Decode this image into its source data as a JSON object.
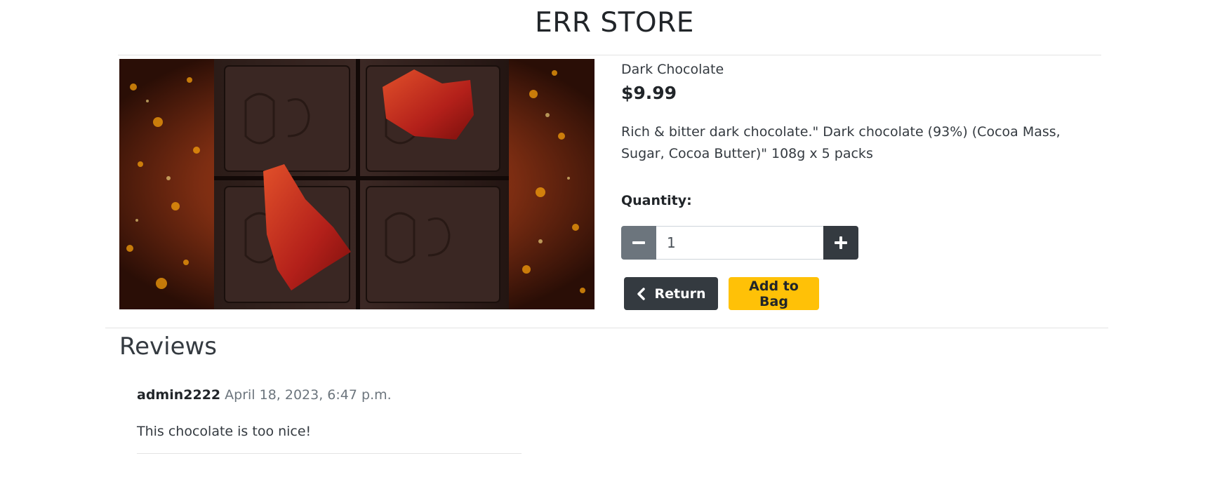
{
  "header": {
    "title": "ERR STORE"
  },
  "product": {
    "image_alt": "Dark Chocolate",
    "name": "Dark Chocolate",
    "price": "$9.99",
    "description": "Rich & bitter dark chocolate.\" Dark chocolate (93%) (Cocoa Mass, Sugar, Cocoa Butter)\" 108g x 5 packs"
  },
  "quantity": {
    "label": "Quantity:",
    "value": "1",
    "decrement_icon": "minus-icon",
    "increment_icon": "plus-icon"
  },
  "actions": {
    "return_label": "Return",
    "return_icon": "chevron-left-icon",
    "add_to_bag_label": "Add to Bag"
  },
  "reviews": {
    "heading": "Reviews",
    "items": [
      {
        "user": "admin2222",
        "date": "April 18, 2023, 6:47 p.m.",
        "body": "This chocolate is too nice!"
      }
    ]
  },
  "colors": {
    "dark": "#343a40",
    "secondary": "#6c757d",
    "warning": "#ffc107",
    "divider": "#e3e3e3"
  }
}
